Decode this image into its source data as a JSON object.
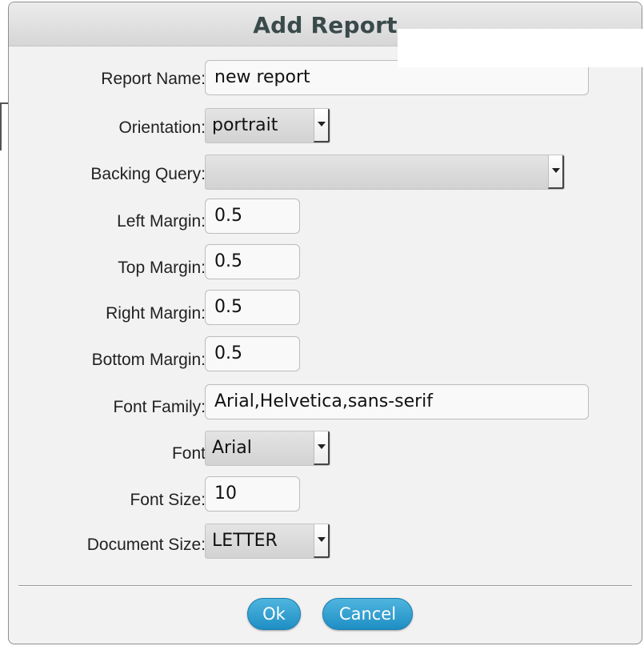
{
  "dialog": {
    "title": "Add Report",
    "fields": {
      "report_name": {
        "label": "Report Name:",
        "value": "new report"
      },
      "orientation": {
        "label": "Orientation:",
        "value": "portrait"
      },
      "backing_query": {
        "label": "Backing Query:",
        "value": ""
      },
      "left_margin": {
        "label": "Left Margin:",
        "value": "0.5"
      },
      "top_margin": {
        "label": "Top Margin:",
        "value": "0.5"
      },
      "right_margin": {
        "label": "Right Margin:",
        "value": "0.5"
      },
      "bottom_margin": {
        "label": "Bottom Margin:",
        "value": "0.5"
      },
      "font_family": {
        "label": "Font Family:",
        "value": "Arial,Helvetica,sans-serif"
      },
      "font": {
        "label": "Font",
        "value": "Arial"
      },
      "font_size": {
        "label": "Font Size:",
        "value": "10"
      },
      "document_size": {
        "label": "Document Size:",
        "value": "LETTER"
      }
    },
    "buttons": {
      "ok": "Ok",
      "cancel": "Cancel"
    }
  },
  "colors": {
    "button_blue": "#2a9fd6",
    "title_text": "#3a4a4a",
    "dialog_bg": "#f2f2f2"
  },
  "icons": {
    "select_arrow": "chevron-down-icon"
  }
}
